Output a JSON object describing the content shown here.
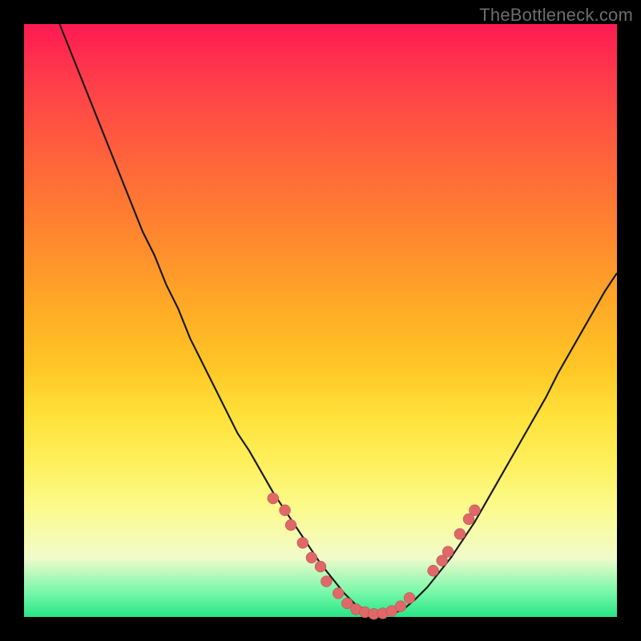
{
  "watermark": "TheBottleneck.com",
  "colors": {
    "background": "#000000",
    "curve": "#1a1a1a",
    "dot_fill": "#e06868",
    "dot_stroke": "#a04646",
    "gradient_top": "#ff1a52",
    "gradient_bottom": "#27e587"
  },
  "chart_data": {
    "type": "line",
    "title": "",
    "xlabel": "",
    "ylabel": "",
    "xlim": [
      0,
      100
    ],
    "ylim": [
      0,
      100
    ],
    "note": "Axes are unlabeled; x and y are normalized 0-100. y=0 is bottom (best), y=100 is top (worst). Curve shows a bottleneck / mismatch profile with a minimum near x≈55.",
    "series": [
      {
        "name": "bottleneck-curve",
        "x": [
          6,
          8,
          10,
          12,
          14,
          16,
          18,
          20,
          22,
          24,
          26,
          28,
          30,
          32,
          34,
          36,
          38,
          40,
          42,
          44,
          46,
          48,
          50,
          52,
          54,
          56,
          58,
          60,
          62,
          64,
          66,
          68,
          70,
          72,
          74,
          76,
          78,
          80,
          82,
          84,
          86,
          88,
          90,
          92,
          94,
          96,
          98,
          100
        ],
        "y": [
          100,
          95,
          90,
          85,
          80,
          75,
          70,
          65,
          61,
          56,
          52,
          47,
          43,
          39,
          35,
          31,
          28,
          24.5,
          21,
          18,
          15,
          12,
          9,
          6.5,
          4,
          2,
          1,
          0.5,
          0.5,
          1.3,
          3,
          5,
          7.5,
          10,
          13,
          16,
          19.5,
          23,
          26.5,
          30,
          33.5,
          37,
          41,
          44.5,
          48,
          51.5,
          55,
          58
        ]
      }
    ],
    "markers": {
      "name": "highlighted-points",
      "description": "Salmon-colored dots clustered near the curve minimum and lower flanks.",
      "points": [
        {
          "x": 42,
          "y": 20
        },
        {
          "x": 44,
          "y": 18
        },
        {
          "x": 45,
          "y": 15.5
        },
        {
          "x": 47,
          "y": 12.5
        },
        {
          "x": 48.5,
          "y": 10
        },
        {
          "x": 50,
          "y": 8.5
        },
        {
          "x": 51,
          "y": 6
        },
        {
          "x": 53,
          "y": 4
        },
        {
          "x": 54.5,
          "y": 2.3
        },
        {
          "x": 56,
          "y": 1.3
        },
        {
          "x": 57.5,
          "y": 0.8
        },
        {
          "x": 59,
          "y": 0.5
        },
        {
          "x": 60.5,
          "y": 0.6
        },
        {
          "x": 62,
          "y": 1.0
        },
        {
          "x": 63.5,
          "y": 1.8
        },
        {
          "x": 65,
          "y": 3.2
        },
        {
          "x": 69,
          "y": 7.8
        },
        {
          "x": 70.5,
          "y": 9.5
        },
        {
          "x": 71.5,
          "y": 11
        },
        {
          "x": 73.5,
          "y": 14
        },
        {
          "x": 75,
          "y": 16.5
        },
        {
          "x": 76,
          "y": 18
        }
      ],
      "radius": 7
    }
  }
}
